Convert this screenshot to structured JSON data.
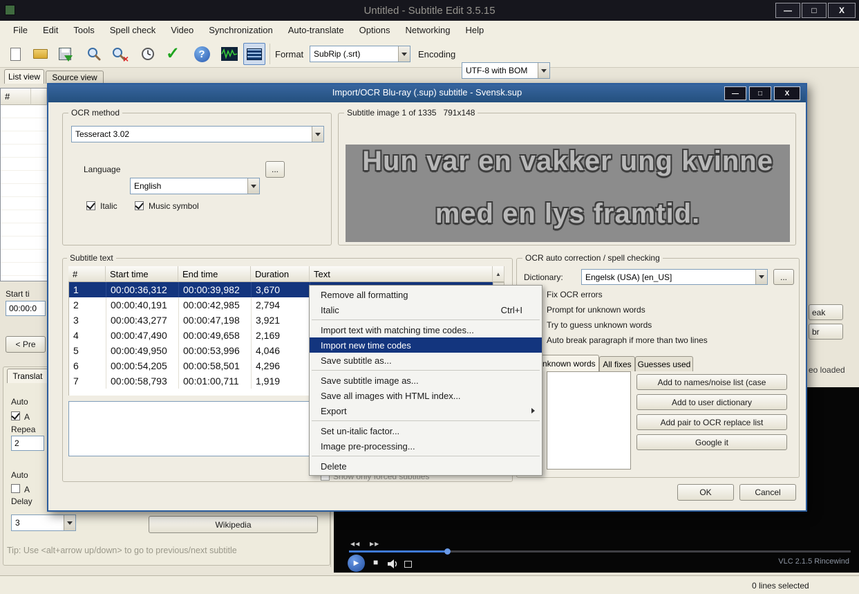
{
  "colors": {
    "selection": "#13357e",
    "dialog_titlebar": "#2b5c9c",
    "progress_blue": "#3f7ad6",
    "subtitle_image_bg": "#8c8c8c"
  },
  "icons": {
    "minimize": "—",
    "maximize": "□",
    "close": "X",
    "check": "✓",
    "question": "?",
    "replace_x": "×",
    "scroll_up": "▲",
    "rewind": "◀◀",
    "forward": "▶▶",
    "play": "▶",
    "stop": "■"
  },
  "window": {
    "title": "Untitled - Subtitle Edit 3.5.15",
    "menu": [
      "File",
      "Edit",
      "Tools",
      "Spell check",
      "Video",
      "Synchronization",
      "Auto-translate",
      "Options",
      "Networking",
      "Help"
    ],
    "toolbar": {
      "format_label": "Format",
      "format_value": "SubRip (.srt)",
      "encoding_label": "Encoding",
      "encoding_value": "UTF-8 with BOM"
    },
    "view_tabs": [
      "List view",
      "Source view"
    ],
    "list_header": "#",
    "left_panel": {
      "start_time_label": "Start ti",
      "start_time_value": "00:00:0",
      "prev_button": "< Pre",
      "translate_tab": "Translat",
      "auto_repeat_group": "Auto",
      "auto_repeat_check": "A",
      "repeat_count_label": "Repea",
      "repeat_count_value": "2",
      "auto_continue_group": "Auto",
      "auto_continue_check": "A",
      "delay_label": "Delay",
      "delay_value": "3",
      "wikipedia_button": "Wikipedia",
      "tip_text": "Tip: Use <alt+arrow up/down> to go to previous/next subtitle"
    },
    "right_panel": {
      "break_button_fragment": "eak",
      "unbreak_button_fragment": "br",
      "video_status_fragment": "eo loaded"
    },
    "video_player": {
      "vlc_label": "VLC 2.1.5 Rincewind"
    },
    "status_bar": "0 lines selected"
  },
  "dialog": {
    "title": "Import/OCR Blu-ray (.sup) subtitle - Svensk.sup",
    "ocr_method": {
      "group_label": "OCR method",
      "method_value": "Tesseract 3.02",
      "language_label": "Language",
      "language_value": "English",
      "browse_button": "...",
      "italic_label": "Italic",
      "music_symbol_label": "Music symbol"
    },
    "subtitle_image": {
      "group_label": "Subtitle image 1 of 1335",
      "dimensions": "791x148",
      "line1": "Hun var en vakker ung kvinne",
      "line2": "med en lys framtid."
    },
    "subtitle_list": {
      "group_label": "Subtitle text",
      "columns": [
        "#",
        "Start time",
        "End time",
        "Duration",
        "Text"
      ],
      "rows": [
        {
          "num": "1",
          "start": "00:00:36,312",
          "end": "00:00:39,982",
          "duration": "3,670"
        },
        {
          "num": "2",
          "start": "00:00:40,191",
          "end": "00:00:42,985",
          "duration": "2,794"
        },
        {
          "num": "3",
          "start": "00:00:43,277",
          "end": "00:00:47,198",
          "duration": "3,921"
        },
        {
          "num": "4",
          "start": "00:00:47,490",
          "end": "00:00:49,658",
          "duration": "2,169"
        },
        {
          "num": "5",
          "start": "00:00:49,950",
          "end": "00:00:53,996",
          "duration": "4,046"
        },
        {
          "num": "6",
          "start": "00:00:54,205",
          "end": "00:00:58,501",
          "duration": "4,296"
        },
        {
          "num": "7",
          "start": "00:00:58,793",
          "end": "00:01:00,711",
          "duration": "1,919"
        }
      ]
    },
    "forced_subtitles_label": "Show only forced subtitles",
    "context_menu": {
      "items": [
        {
          "label": "Remove all formatting"
        },
        {
          "label": "Italic",
          "shortcut": "Ctrl+I"
        },
        {
          "label": "Import text with matching time codes..."
        },
        {
          "label": "Import new time codes"
        },
        {
          "label": "Save subtitle as..."
        },
        {
          "label": "Save subtitle image as..."
        },
        {
          "label": "Save all images with HTML index..."
        },
        {
          "label": "Export"
        },
        {
          "label": "Set un-italic factor..."
        },
        {
          "label": "Image pre-processing..."
        },
        {
          "label": "Delete"
        }
      ]
    },
    "ocr_correction": {
      "group_label": "OCR auto correction / spell checking",
      "dictionary_label": "Dictionary:",
      "dictionary_value": "Engelsk (USA) [en_US]",
      "browse_button": "...",
      "fix_ocr_errors_label": "Fix OCR errors",
      "prompt_unknown_label": "Prompt for unknown words",
      "guess_unknown_label": "Try to guess unknown words",
      "auto_break_label": "Auto break paragraph if more than two lines",
      "tabs": [
        "Unknown words",
        "All fixes",
        "Guesses used"
      ],
      "buttons": [
        "Add to names/noise list (case",
        "Add to user dictionary",
        "Add pair to OCR replace list",
        "Google it"
      ]
    },
    "ok_button": "OK",
    "cancel_button": "Cancel"
  }
}
